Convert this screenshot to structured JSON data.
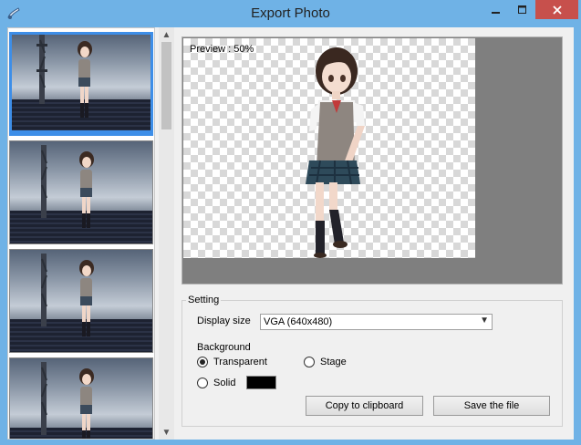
{
  "window": {
    "title": "Export Photo"
  },
  "preview": {
    "label": "Preview : 50%"
  },
  "settings": {
    "legend": "Setting",
    "display_size_label": "Display size",
    "display_size_value": "VGA (640x480)",
    "background_label": "Background",
    "options": {
      "transparent": "Transparent",
      "stage": "Stage",
      "solid": "Solid"
    },
    "selected_background": "Transparent",
    "solid_color": "#000000",
    "copy_button": "Copy to clipboard",
    "save_button": "Save the file"
  },
  "colors": {
    "titlebar": "#6fb2e6",
    "selection": "#3d8ee8",
    "close_button": "#c7504c"
  },
  "icons": [
    "app-icon",
    "minimize-icon",
    "maximize-icon",
    "close-icon",
    "scroll-up-arrow-icon",
    "scroll-down-arrow-icon",
    "dropdown-arrow-icon"
  ]
}
